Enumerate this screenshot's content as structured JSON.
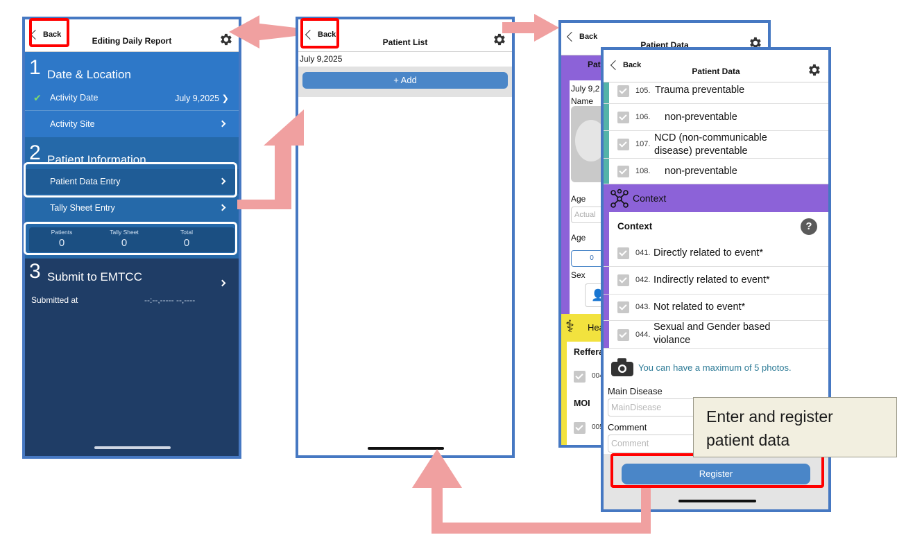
{
  "screen1": {
    "back_label": "Back",
    "title": "Editing Daily Report",
    "gear_icon": "gear-icon",
    "section1": {
      "number": "1",
      "title": "Date & Location"
    },
    "activity_date": {
      "label": "Activity Date",
      "value": "July 9,2025 ❯"
    },
    "activity_site": {
      "label": "Activity Site"
    },
    "section2": {
      "number": "2",
      "title": "Patient Information"
    },
    "patient_data_entry": {
      "label": "Patient Data Entry"
    },
    "tally_sheet_entry": {
      "label": "Tally Sheet Entry"
    },
    "counts": [
      {
        "label": "Patients",
        "value": "0"
      },
      {
        "label": "Tally Sheet",
        "value": "0"
      },
      {
        "label": "Total",
        "value": "0"
      }
    ],
    "section3": {
      "number": "3",
      "title": "Submit to EMTCC"
    },
    "submitted": {
      "label": "Submitted at",
      "value": "--:--,----- --,----"
    }
  },
  "screen2": {
    "back_label": "Back",
    "title": "Patient List",
    "date": "July 9,2025",
    "add_label": "+    Add"
  },
  "screen3": {
    "back_label": "Back",
    "title": "Patient Data",
    "tab_fragment": "Pat",
    "date_fragment": "July 9,2",
    "name_label": "Name",
    "age_label": "Age",
    "age_placeholder": "Actual",
    "age_label2": "Age",
    "age_value": "0",
    "sex_label": "Sex",
    "health_fragment": "Hea",
    "referral_fragment": "Reffera",
    "code_fragment_1": "004",
    "moi_label": "MOI",
    "code_fragment_2": "005"
  },
  "screen4": {
    "back_label": "Back",
    "title": "Patient Data",
    "items_top": [
      {
        "num": "105.",
        "text": "Trauma preventable"
      },
      {
        "num": "106.",
        "text": "non-preventable"
      },
      {
        "num": "107.",
        "text": "NCD (non-communicable disease) preventable"
      },
      {
        "num": "108.",
        "text": "non-preventable"
      }
    ],
    "context_band": "Context",
    "context_heading": "Context",
    "help_label": "?",
    "context_items": [
      {
        "num": "041.",
        "text": "Directly related to event*"
      },
      {
        "num": "042.",
        "text": "Indirectly related to event*"
      },
      {
        "num": "043.",
        "text": "Not related to event*"
      },
      {
        "num": "044.",
        "text": "Sexual and Gender based violance"
      }
    ],
    "photo_note": "You can have a maximum of 5 photos.",
    "main_disease_label": "Main Disease",
    "main_disease_placeholder": "MainDisease",
    "comment_label": "Comment",
    "comment_placeholder": "Comment",
    "register_label": "Register"
  },
  "callout": {
    "line1": "Enter and register",
    "line2": "patient data"
  },
  "colors": {
    "arrow": "#f0a0a0",
    "highlight_red": "#ff0000",
    "phone_border": "#4678c2",
    "context_purple": "#8c62d8",
    "button_blue": "#4a86c8"
  }
}
